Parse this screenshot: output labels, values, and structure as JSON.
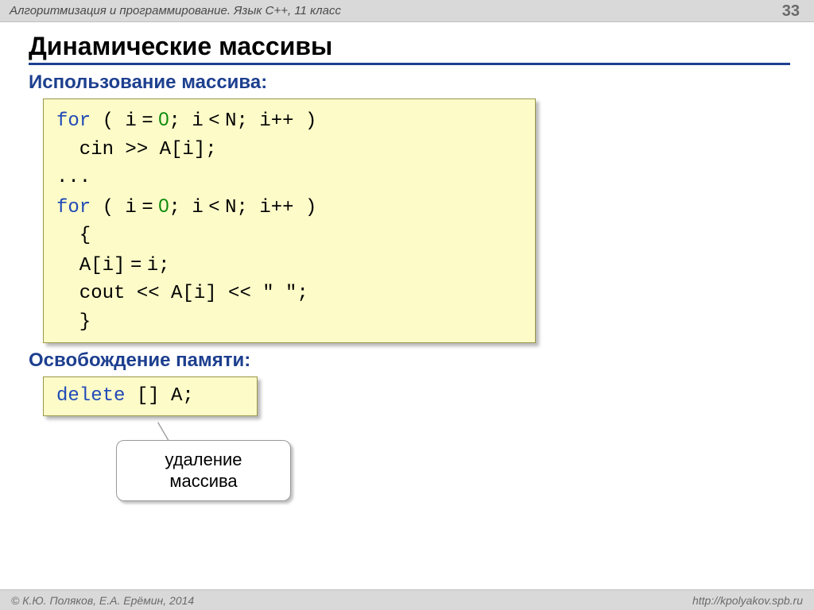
{
  "header": {
    "breadcrumb": "Алгоритмизация и программирование. Язык C++, 11 класс",
    "page_number": "33"
  },
  "title": "Динамические массивы",
  "section1": {
    "heading": "Использование массива:"
  },
  "code1": {
    "l1_kw": "for",
    "l1a": " ( i",
    "l1_eq": " = ",
    "l1_zero": "0",
    "l1b": "; i",
    "l1_lt": " < ",
    "l1c": "N; i++ )",
    "l2": "  cin >> A[i];",
    "l3": "...",
    "l4_kw": "for",
    "l4a": " ( i",
    "l4_eq": " = ",
    "l4_zero": "0",
    "l4b": "; i",
    "l4_lt": " < ",
    "l4c": "N; i++ )",
    "l5": "  {",
    "l6a": "  A[i]",
    "l6_eq": " = ",
    "l6b": "i;",
    "l7": "  cout << A[i] << \" \";",
    "l8": "  }"
  },
  "section2": {
    "heading": "Освобождение памяти:"
  },
  "code2": {
    "kw": "delete",
    "rest": " [] A;"
  },
  "callout": {
    "line1": "удаление",
    "line2": "массива"
  },
  "footer": {
    "copyright": "© К.Ю. Поляков, Е.А. Ерёмин, 2014",
    "url": "http://kpolyakov.spb.ru"
  }
}
